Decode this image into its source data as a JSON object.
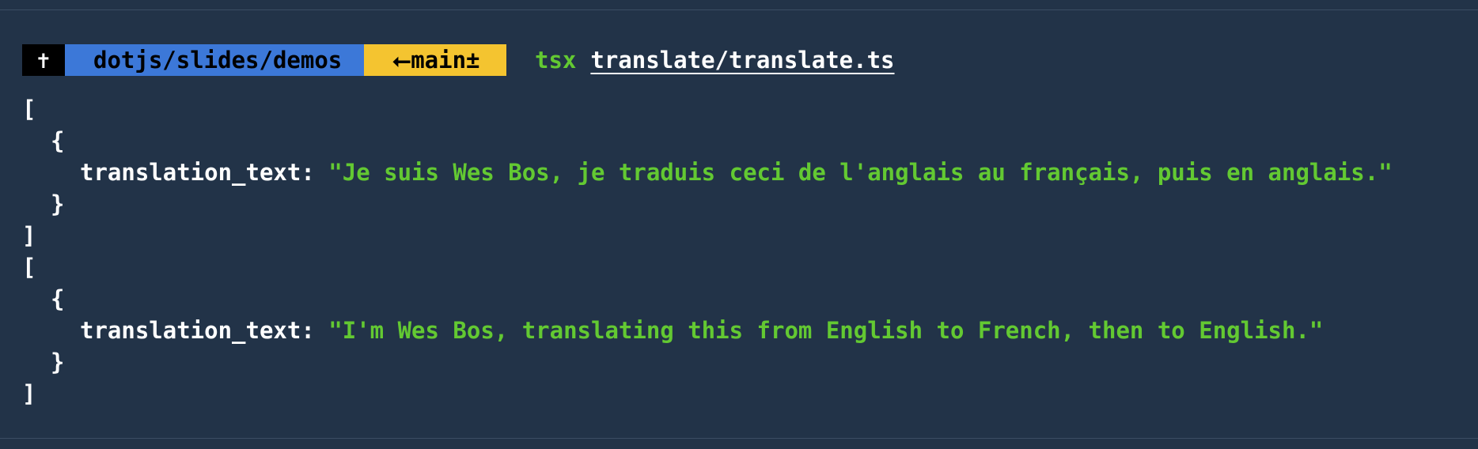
{
  "prompt": {
    "root_glyph": "✝",
    "path": "dotjs/slides/demos",
    "branch_arrow": "⭠",
    "branch": "main±",
    "command": "tsx",
    "argument": "translate/translate.ts"
  },
  "output": {
    "results": [
      {
        "open_bracket": "[",
        "open_brace": "{",
        "key": "translation_text:",
        "value": "\"Je suis Wes Bos, je traduis ceci de l'anglais au français, puis en anglais.\"",
        "close_brace": "}",
        "close_bracket": "]"
      },
      {
        "open_bracket": "[",
        "open_brace": "{",
        "key": "translation_text:",
        "value": "\"I'm Wes Bos, translating this from English to French, then to English.\"",
        "close_brace": "}",
        "close_bracket": "]"
      }
    ]
  },
  "colors": {
    "background": "#223348",
    "path_segment": "#3c78d8",
    "branch_segment": "#f4c430",
    "command": "#63c932",
    "string": "#63c932"
  }
}
